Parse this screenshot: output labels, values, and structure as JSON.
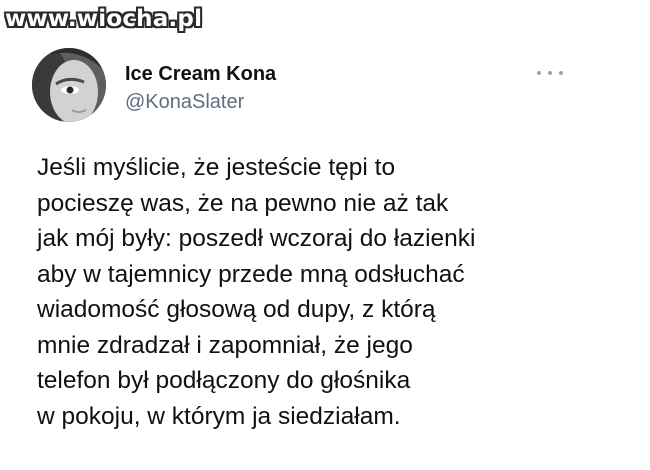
{
  "watermark": {
    "text": "www.wiocha.pl"
  },
  "author": {
    "display_name": "Ice Cream Kona",
    "handle": "@KonaSlater",
    "avatar_icon": "profile-photo"
  },
  "menu": {
    "icon": "more-options-icon"
  },
  "tweet": {
    "lines": [
      "Jeśli myślicie, że jesteście tępi to",
      "pocieszę was, że na pewno nie aż tak",
      "jak mój były: poszedł wczoraj do łazienki",
      "aby w tajemnicy przede mną odsłuchać",
      "wiadomość głosową od dupy, z którą",
      "mnie zdradzał i zapomniał, że jego",
      "telefon był podłączony do głośnika",
      "w pokoju, w którym ja siedziałam."
    ]
  },
  "colors": {
    "text_primary": "#111111",
    "text_secondary": "#5b7083",
    "background": "#ffffff"
  }
}
